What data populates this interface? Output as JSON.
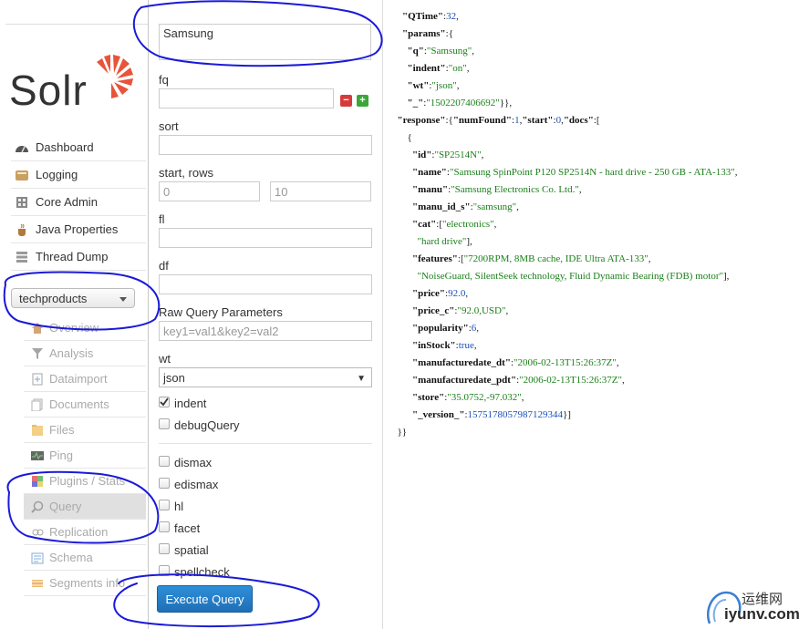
{
  "app": {
    "logo_text": "Solr"
  },
  "sidebar": {
    "nav": [
      {
        "label": "Dashboard",
        "icon": "dashboard-icon"
      },
      {
        "label": "Logging",
        "icon": "logging-icon"
      },
      {
        "label": "Core Admin",
        "icon": "core-admin-icon"
      },
      {
        "label": "Java Properties",
        "icon": "java-properties-icon"
      },
      {
        "label": "Thread Dump",
        "icon": "thread-dump-icon"
      }
    ],
    "core_selector": {
      "value": "techproducts"
    },
    "core_menu": [
      {
        "label": "Overview",
        "icon": "home-icon"
      },
      {
        "label": "Analysis",
        "icon": "funnel-icon"
      },
      {
        "label": "Dataimport",
        "icon": "dataimport-icon"
      },
      {
        "label": "Documents",
        "icon": "documents-icon"
      },
      {
        "label": "Files",
        "icon": "folder-icon"
      },
      {
        "label": "Ping",
        "icon": "ping-icon"
      },
      {
        "label": "Plugins / Stats",
        "icon": "plugins-icon"
      },
      {
        "label": "Query",
        "icon": "magnifier-icon"
      },
      {
        "label": "Replication",
        "icon": "replication-icon"
      },
      {
        "label": "Schema",
        "icon": "schema-icon"
      },
      {
        "label": "Segments info",
        "icon": "segments-icon"
      }
    ]
  },
  "form": {
    "q_value": "Samsung",
    "fq_label": "fq",
    "fq_value": "",
    "sort_label": "sort",
    "sort_value": "",
    "start_rows_label": "start, rows",
    "start_value": "0",
    "rows_value": "10",
    "fl_label": "fl",
    "fl_value": "",
    "df_label": "df",
    "df_value": "",
    "raw_label": "Raw Query Parameters",
    "raw_placeholder": "key1=val1&key2=val2",
    "wt_label": "wt",
    "wt_value": "json",
    "checks": [
      {
        "label": "indent",
        "checked": true
      },
      {
        "label": "debugQuery",
        "checked": false
      },
      {
        "label": "dismax",
        "checked": false
      },
      {
        "label": "edismax",
        "checked": false
      },
      {
        "label": "hl",
        "checked": false
      },
      {
        "label": "facet",
        "checked": false
      },
      {
        "label": "spatial",
        "checked": false
      },
      {
        "label": "spellcheck",
        "checked": false
      }
    ],
    "execute_label": "Execute Query"
  },
  "response": {
    "lines": [
      "    \"QTime\":32,",
      "    \"params\":{",
      "      \"q\":\"Samsung\",",
      "      \"indent\":\"on\",",
      "      \"wt\":\"json\",",
      "      \"_\":\"1502207406692\"}},",
      "  \"response\":{\"numFound\":1,\"start\":0,\"docs\":[",
      "      {",
      "        \"id\":\"SP2514N\",",
      "        \"name\":\"Samsung SpinPoint P120 SP2514N - hard drive - 250 GB - ATA-133\",",
      "        \"manu\":\"Samsung Electronics Co. Ltd.\",",
      "        \"manu_id_s\":\"samsung\",",
      "        \"cat\":[\"electronics\",",
      "          \"hard drive\"],",
      "        \"features\":[\"7200RPM, 8MB cache, IDE Ultra ATA-133\",",
      "          \"NoiseGuard, SilentSeek technology, Fluid Dynamic Bearing (FDB) motor\"],",
      "        \"price\":92.0,",
      "        \"price_c\":\"92.0,USD\",",
      "        \"popularity\":6,",
      "        \"inStock\":true,",
      "        \"manufacturedate_dt\":\"2006-02-13T15:26:37Z\",",
      "        \"manufacturedate_pdt\":\"2006-02-13T15:26:37Z\",",
      "        \"store\":\"35.0752,-97.032\",",
      "        \"_version_\":1575178057987129344}]",
      "  }}"
    ]
  },
  "watermark": {
    "cn": "运维网",
    "en": "iyunv.com"
  },
  "colors": {
    "accent": "#1f6fb5",
    "annotation": "#1a1ad8",
    "logo": "#e8533a"
  }
}
